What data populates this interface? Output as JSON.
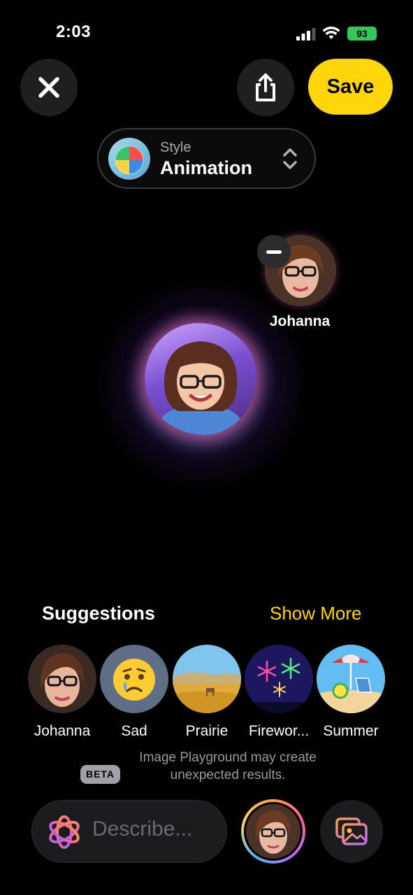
{
  "status_bar": {
    "time": "2:03",
    "battery": "93"
  },
  "toolbar": {
    "save_label": "Save"
  },
  "style_picker": {
    "label": "Style",
    "value": "Animation"
  },
  "people": [
    {
      "name": "Johanna"
    }
  ],
  "suggestions": {
    "title": "Suggestions",
    "show_more": "Show More",
    "items": [
      {
        "label": "Johanna",
        "icon": "person-photo"
      },
      {
        "label": "Sad",
        "icon": "crying-face"
      },
      {
        "label": "Prairie",
        "icon": "prairie-scene"
      },
      {
        "label": "Firewor...",
        "icon": "fireworks-scene"
      },
      {
        "label": "Summer",
        "icon": "beach-scene"
      }
    ]
  },
  "notice": {
    "badge": "BETA",
    "text": "Image Playground may create unexpected results."
  },
  "composer": {
    "placeholder": "Describe..."
  },
  "colors": {
    "accent": "#ffd60a",
    "background": "#000000",
    "battery": "#34c759"
  }
}
